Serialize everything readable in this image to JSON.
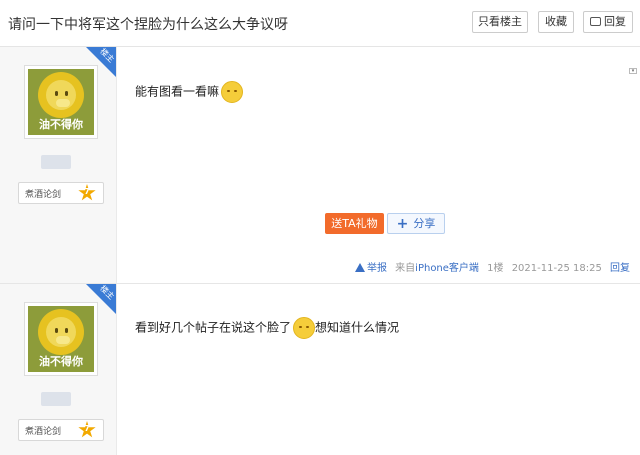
{
  "header": {
    "title": "请问一下中将军这个捏脸为什么这么大争议呀",
    "buttons": {
      "only_lz": "只看楼主",
      "favorite": "收藏",
      "reply": "回复"
    }
  },
  "posts": [
    {
      "lz_badge": "楼主",
      "avatar_name": "油不得你",
      "rank_label": "煮酒论剑",
      "rank_level": "7",
      "content_before": "能有图看一看嘛",
      "content_after": "",
      "gift_label": "送TA礼物",
      "share_label": "分享",
      "report_label": "举报",
      "source_prefix": "来自",
      "source_client": "iPhone客户端",
      "floor": "1楼",
      "time": "2021-11-25 18:25",
      "reply_label": "回复"
    },
    {
      "lz_badge": "楼主",
      "avatar_name": "油不得你",
      "rank_label": "煮酒论剑",
      "rank_level": "7",
      "content_before": "看到好几个帖子在说这个脸了",
      "content_after": "想知道什么情况"
    }
  ],
  "icons": {
    "dropdown": "caret-down-icon",
    "emoji": "shy-face-icon",
    "report": "warning-icon",
    "rank": "star-icon"
  },
  "colors": {
    "accent_blue": "#3a7bd5",
    "gift_orange": "#f26b2b",
    "link_blue": "#3a6fc4"
  }
}
